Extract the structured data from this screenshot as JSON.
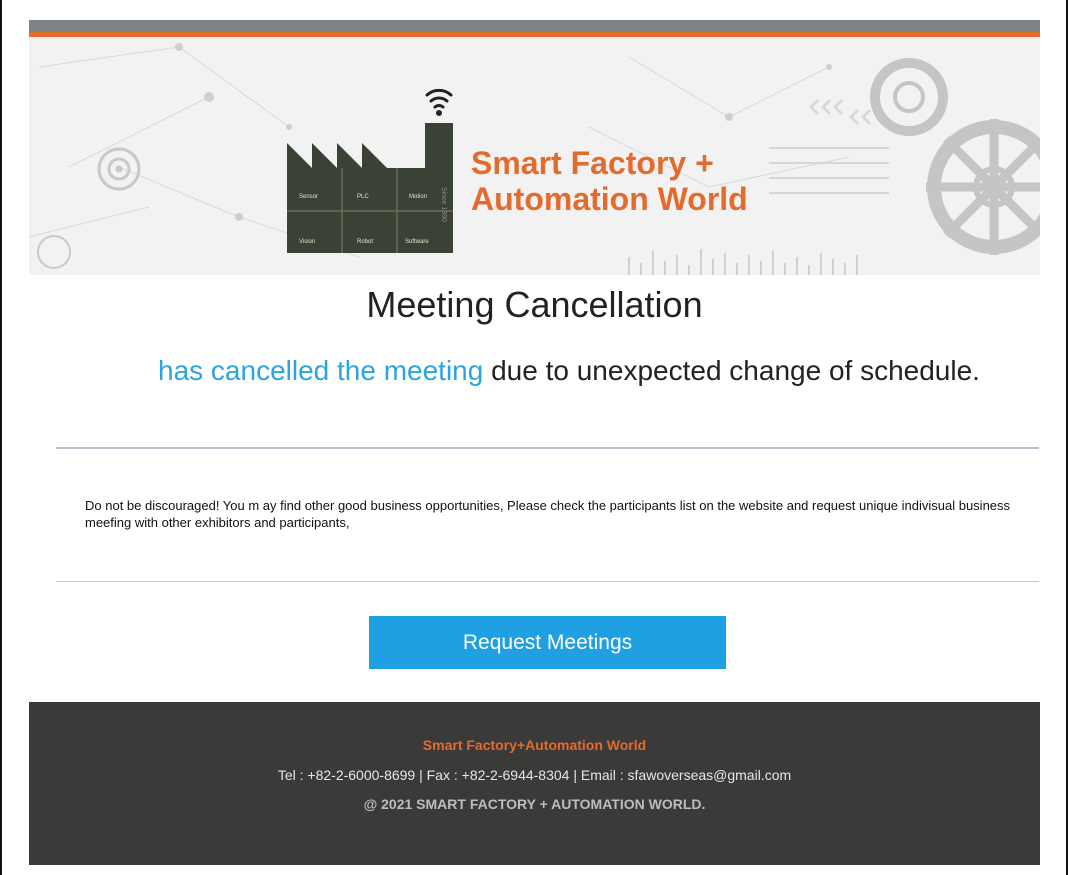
{
  "header": {
    "brand_line1": "Smart Factory +",
    "brand_line2": "Automation World",
    "factory_labels": [
      "Sensor",
      "PLC",
      "Motion",
      "Vision",
      "Robot",
      "Software"
    ],
    "vertical_text": "Since 1990"
  },
  "main": {
    "title": "Meeting Cancellation",
    "message_link": "has cancelled the meeting",
    "message_rest": " due to unexpected change of schedule.",
    "note": "Do not be discouraged! You m ay find other good business opportunities, Please check the participants list on the website and request unique indivisual business meefing with other exhibitors and participants,",
    "button_label": "Request Meetings"
  },
  "footer": {
    "name": "Smart Factory+Automation World",
    "contact": "Tel : +82-2-6000-8699  |  Fax : +82-2-6944-8304  |  Email : sfawoverseas@gmail.com",
    "copyright": "@ 2021 SMART FACTORY + AUTOMATION WORLD."
  },
  "colors": {
    "accent_orange": "#e46b2e",
    "link_blue": "#2ba4e0",
    "button_blue": "#1fa0e3",
    "footer_bg": "#3a3a38",
    "topbar_gray": "#7f8388"
  }
}
